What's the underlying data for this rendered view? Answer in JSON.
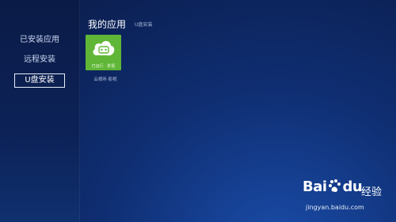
{
  "sidebar": {
    "items": [
      {
        "label": "已安装应用",
        "active": false
      },
      {
        "label": "远程安装",
        "active": false
      },
      {
        "label": "U盘安装",
        "active": true
      }
    ]
  },
  "header": {
    "title": "我的应用",
    "subtitle": "U盘安装"
  },
  "apps": [
    {
      "name": "云视听·影视",
      "badge": "已运行 · 影视",
      "icon": "cloud-face-icon",
      "tile_color": "#5fb637"
    }
  ],
  "watermark": {
    "brand": "Bai",
    "brand_tail": "du",
    "jingyan": "经验",
    "url": "jingyan.baidu.com"
  }
}
